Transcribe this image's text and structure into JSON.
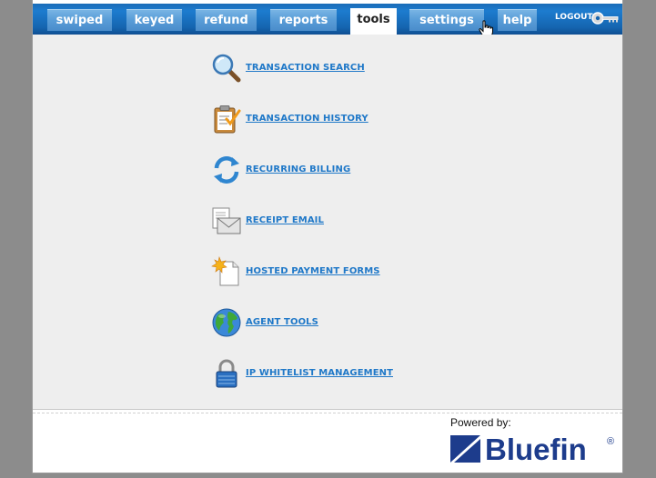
{
  "nav": {
    "tabs": [
      {
        "label": "swiped",
        "active": false
      },
      {
        "label": "keyed",
        "active": false
      },
      {
        "label": "refund",
        "active": false
      },
      {
        "label": "reports",
        "active": false
      },
      {
        "label": "tools",
        "active": true
      },
      {
        "label": "settings",
        "active": false
      },
      {
        "label": "help",
        "active": false
      }
    ],
    "logout_label": "LOGOUT"
  },
  "tools": [
    {
      "label": "TRANSACTION SEARCH",
      "icon": "magnifier-icon"
    },
    {
      "label": "TRANSACTION HISTORY",
      "icon": "clipboard-check-icon"
    },
    {
      "label": "RECURRING BILLING",
      "icon": "refresh-arrows-icon"
    },
    {
      "label": "RECEIPT EMAIL",
      "icon": "envelope-document-icon"
    },
    {
      "label": "HOSTED PAYMENT FORMS",
      "icon": "new-document-icon"
    },
    {
      "label": "AGENT TOOLS",
      "icon": "globe-icon"
    },
    {
      "label": "IP WHITELIST MANAGEMENT",
      "icon": "padlock-icon"
    }
  ],
  "footer": {
    "powered_by": "Powered by:",
    "brand": "Bluefin",
    "registered_mark": "®"
  },
  "colors": {
    "nav_blue": "#1565b0",
    "tab_blue": "#5a9ed8",
    "link_blue": "#1f78c8",
    "content_bg": "#eeeeee",
    "brand_navy": "#1d3c8c"
  }
}
